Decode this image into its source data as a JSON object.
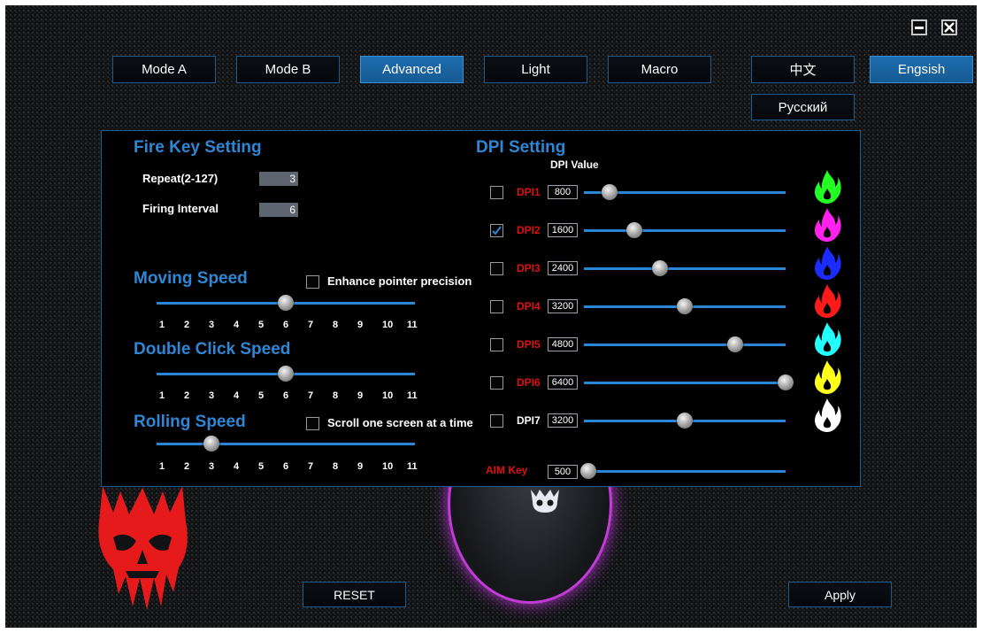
{
  "window": {
    "minimize_icon": "minimize-icon",
    "close_icon": "close-icon"
  },
  "tabs": [
    {
      "label": "Mode A",
      "active": false
    },
    {
      "label": "Mode B",
      "active": false
    },
    {
      "label": "Advanced",
      "active": true
    },
    {
      "label": "Light",
      "active": false
    },
    {
      "label": "Macro",
      "active": false
    }
  ],
  "languages": {
    "chinese": "中文",
    "english": "Engsish",
    "russian": "Русский"
  },
  "fire_key": {
    "title": "Fire Key Setting",
    "repeat_label": "Repeat(2-127)",
    "repeat_value": "3",
    "interval_label": "Firing Interval",
    "interval_value": "6"
  },
  "moving_speed": {
    "title": "Moving Speed",
    "checkbox_label": "Enhance pointer precision",
    "checked": false,
    "value": 6,
    "ticks": [
      "1",
      "2",
      "3",
      "4",
      "5",
      "6",
      "7",
      "8",
      "9",
      "10",
      "11"
    ]
  },
  "double_click": {
    "title": "Double Click Speed",
    "value": 6,
    "ticks": [
      "1",
      "2",
      "3",
      "4",
      "5",
      "6",
      "7",
      "8",
      "9",
      "10",
      "11"
    ]
  },
  "rolling_speed": {
    "title": "Rolling Speed",
    "checkbox_label": "Scroll one screen at a time",
    "checked": false,
    "value": 3,
    "ticks": [
      "1",
      "2",
      "3",
      "4",
      "5",
      "6",
      "7",
      "8",
      "9",
      "10",
      "11"
    ]
  },
  "dpi": {
    "title": "DPI Setting",
    "column_header": "DPI Value",
    "max": 6400,
    "levels": [
      {
        "label": "DPI1",
        "value": "800",
        "checked": false,
        "label_color": "#e01010",
        "flame_color": "#22ff22"
      },
      {
        "label": "DPI2",
        "value": "1600",
        "checked": true,
        "label_color": "#e01010",
        "flame_color": "#ff22ee"
      },
      {
        "label": "DPI3",
        "value": "2400",
        "checked": false,
        "label_color": "#e01010",
        "flame_color": "#1a2cff"
      },
      {
        "label": "DPI4",
        "value": "3200",
        "checked": false,
        "label_color": "#e01010",
        "flame_color": "#ff1a1a"
      },
      {
        "label": "DPI5",
        "value": "4800",
        "checked": false,
        "label_color": "#e01010",
        "flame_color": "#22ffff"
      },
      {
        "label": "DPI6",
        "value": "6400",
        "checked": false,
        "label_color": "#e01010",
        "flame_color": "#ffff1a"
      },
      {
        "label": "DPI7",
        "value": "3200",
        "checked": false,
        "label_color": "#ffffff",
        "flame_color": "#ffffff"
      }
    ],
    "aim_key": {
      "label": "AIM Key",
      "value": "500",
      "label_color": "#e01010"
    }
  },
  "buttons": {
    "reset": "RESET",
    "apply": "Apply"
  },
  "colors": {
    "accent": "#2f86d4",
    "active_tab": "#1e6cae",
    "skull": "#e61a1a"
  }
}
